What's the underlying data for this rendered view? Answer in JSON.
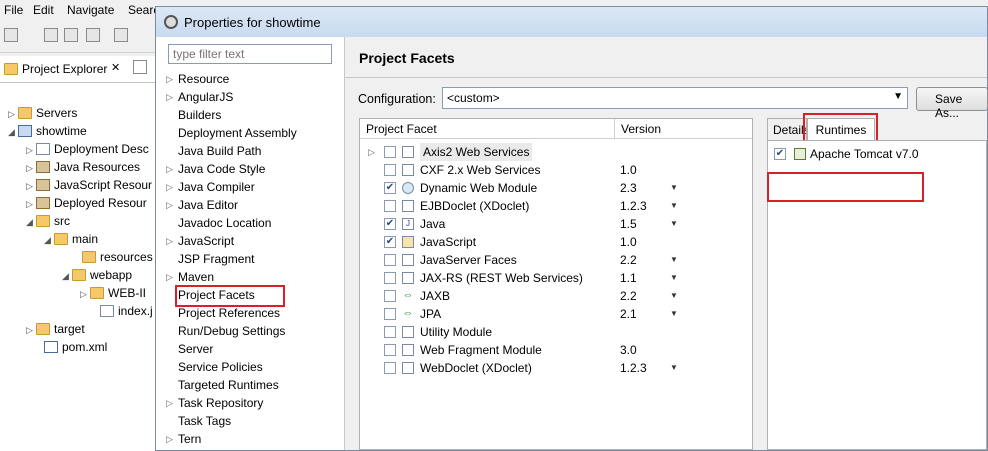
{
  "menubar": [
    "File",
    "Edit",
    "Navigate",
    "Searc"
  ],
  "explorer": {
    "tab_label": "Project Explorer",
    "items": [
      {
        "label": "Servers",
        "arrow": "▷"
      },
      {
        "label": "showtime",
        "arrow": "◢"
      },
      {
        "label": "Deployment Desc",
        "arrow": "▷"
      },
      {
        "label": "Java Resources",
        "arrow": "▷"
      },
      {
        "label": "JavaScript Resour",
        "arrow": "▷"
      },
      {
        "label": "Deployed Resour",
        "arrow": "▷"
      },
      {
        "label": "src",
        "arrow": "◢"
      },
      {
        "label": "main",
        "arrow": "◢"
      },
      {
        "label": "resources",
        "arrow": ""
      },
      {
        "label": "webapp",
        "arrow": "◢"
      },
      {
        "label": "WEB-II",
        "arrow": "▷"
      },
      {
        "label": "index.j",
        "arrow": ""
      },
      {
        "label": "target",
        "arrow": "▷"
      },
      {
        "label": "pom.xml",
        "arrow": ""
      }
    ]
  },
  "dialog": {
    "title": "Properties for showtime",
    "filter_placeholder": "type filter text",
    "nav": [
      {
        "label": "Resource",
        "arrow": "▷"
      },
      {
        "label": "AngularJS",
        "arrow": "▷"
      },
      {
        "label": "Builders",
        "arrow": ""
      },
      {
        "label": "Deployment Assembly",
        "arrow": ""
      },
      {
        "label": "Java Build Path",
        "arrow": ""
      },
      {
        "label": "Java Code Style",
        "arrow": "▷"
      },
      {
        "label": "Java Compiler",
        "arrow": "▷"
      },
      {
        "label": "Java Editor",
        "arrow": "▷"
      },
      {
        "label": "Javadoc Location",
        "arrow": ""
      },
      {
        "label": "JavaScript",
        "arrow": "▷"
      },
      {
        "label": "JSP Fragment",
        "arrow": ""
      },
      {
        "label": "Maven",
        "arrow": "▷"
      },
      {
        "label": "Project Facets",
        "arrow": ""
      },
      {
        "label": "Project References",
        "arrow": ""
      },
      {
        "label": "Run/Debug Settings",
        "arrow": ""
      },
      {
        "label": "Server",
        "arrow": ""
      },
      {
        "label": "Service Policies",
        "arrow": ""
      },
      {
        "label": "Targeted Runtimes",
        "arrow": ""
      },
      {
        "label": "Task Repository",
        "arrow": "▷"
      },
      {
        "label": "Task Tags",
        "arrow": ""
      },
      {
        "label": "Tern",
        "arrow": "▷"
      }
    ],
    "page_title": "Project Facets",
    "config_label": "Configuration:",
    "config_value": "<custom>",
    "save_as": "Save As...",
    "table": {
      "col_facet": "Project Facet",
      "col_version": "Version",
      "rows": [
        {
          "name": "Axis2 Web Services",
          "version": "",
          "checked": false,
          "expand": true,
          "dd": false
        },
        {
          "name": "CXF 2.x Web Services",
          "version": "1.0",
          "checked": false,
          "expand": false,
          "dd": false
        },
        {
          "name": "Dynamic Web Module",
          "version": "2.3",
          "checked": true,
          "expand": false,
          "dd": true
        },
        {
          "name": "EJBDoclet (XDoclet)",
          "version": "1.2.3",
          "checked": false,
          "expand": false,
          "dd": true
        },
        {
          "name": "Java",
          "version": "1.5",
          "checked": true,
          "expand": false,
          "dd": true
        },
        {
          "name": "JavaScript",
          "version": "1.0",
          "checked": true,
          "expand": false,
          "dd": false
        },
        {
          "name": "JavaServer Faces",
          "version": "2.2",
          "checked": false,
          "expand": false,
          "dd": true
        },
        {
          "name": "JAX-RS (REST Web Services)",
          "version": "1.1",
          "checked": false,
          "expand": false,
          "dd": true
        },
        {
          "name": "JAXB",
          "version": "2.2",
          "checked": false,
          "expand": false,
          "dd": true
        },
        {
          "name": "JPA",
          "version": "2.1",
          "checked": false,
          "expand": false,
          "dd": true
        },
        {
          "name": "Utility Module",
          "version": "",
          "checked": false,
          "expand": false,
          "dd": false
        },
        {
          "name": "Web Fragment Module",
          "version": "3.0",
          "checked": false,
          "expand": false,
          "dd": false
        },
        {
          "name": "WebDoclet (XDoclet)",
          "version": "1.2.3",
          "checked": false,
          "expand": false,
          "dd": true
        }
      ]
    },
    "tabs": {
      "details": "Details",
      "runtimes": "Runtimes"
    },
    "runtime": {
      "name": "Apache Tomcat v7.0",
      "checked": true
    }
  },
  "colors": {
    "highlight": "#d9202a"
  }
}
